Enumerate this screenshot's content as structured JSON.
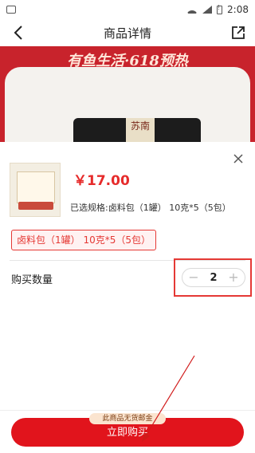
{
  "status_bar": {
    "time": "2:08"
  },
  "nav": {
    "title": "商品详情"
  },
  "banner": {
    "promo_text": "有鱼生活·618预热"
  },
  "product_image": {
    "jar_label": "苏南"
  },
  "sheet": {
    "price": "￥17.00",
    "selected_spec": "已选规格:卤料包（1罐） 10克*5（5包）",
    "spec_option": "卤料包（1罐） 10克*5（5包）",
    "quantity_label": "购买数量",
    "quantity_value": "2",
    "minus_symbol": "−",
    "plus_symbol": "+"
  },
  "footer": {
    "free_shipping_badge": "此商品无货邮金",
    "buy_now_label": "立即购买"
  },
  "colors": {
    "accent_red": "#e1141c",
    "promo_red": "#c8232c",
    "price_red": "#e62b2b"
  }
}
